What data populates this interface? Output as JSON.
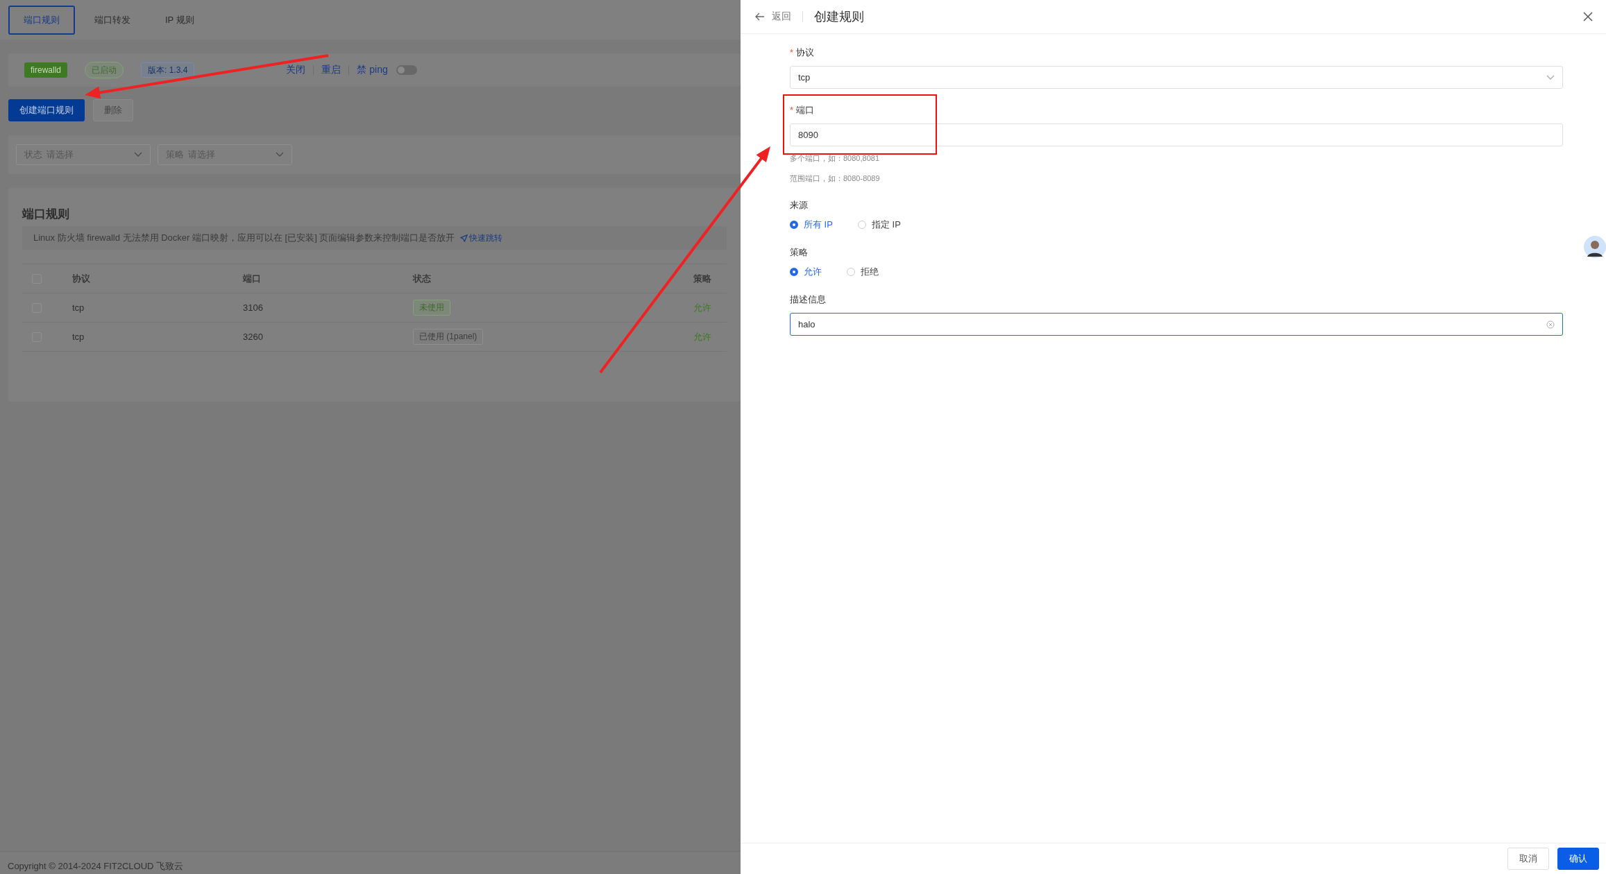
{
  "tabs": [
    {
      "label": "端口规则",
      "selected": true
    },
    {
      "label": "端口转发",
      "selected": false
    },
    {
      "label": "IP 规则",
      "selected": false
    }
  ],
  "status_bar": {
    "name": "firewalld",
    "state": "已启动",
    "version": "版本: 1.3.4",
    "actions": [
      "关闭",
      "重启"
    ],
    "ping_label": "禁 ping",
    "ping_on": false
  },
  "toolbar": [
    {
      "label": "创建端口规则",
      "kind": "primary",
      "disabled": false
    },
    {
      "label": "删除",
      "kind": "default",
      "disabled": true
    }
  ],
  "filters": [
    {
      "label": "状态",
      "placeholder": "请选择"
    },
    {
      "label": "策略",
      "placeholder": "请选择"
    }
  ],
  "rules_card": {
    "title": "端口规则",
    "notice": "Linux 防火墙 firewalld 无法禁用 Docker 端口映射，应用可以在 [已安装] 页面编辑参数来控制端口是否放开",
    "notice_link": "快速跳转",
    "all_checked": false,
    "columns": [
      "协议",
      "端口",
      "状态",
      "策略"
    ],
    "rows": [
      {
        "protocol": "tcp",
        "port": "3106",
        "status": {
          "label": "未使用",
          "kind": "unused"
        },
        "strategy": "允许",
        "checked": false
      },
      {
        "protocol": "tcp",
        "port": "3260",
        "status": {
          "label": "已使用 (1panel)",
          "kind": "used"
        },
        "strategy": "允许",
        "checked": false
      }
    ]
  },
  "footer": "Copyright © 2014-2024 FIT2CLOUD 飞致云",
  "drawer": {
    "back": "返回",
    "title": "创建规则",
    "required_mark": "*",
    "fields": [
      {
        "kind": "select",
        "label": "协议",
        "required": true,
        "value": "tcp"
      },
      {
        "kind": "input",
        "label": "端口",
        "required": true,
        "value": "8090",
        "focused": false,
        "clearable": false,
        "hints": [
          "多个端口，如：8080,8081",
          "范围端口，如：8080-8089"
        ]
      },
      {
        "kind": "radio",
        "label": "来源",
        "required": false,
        "options": [
          {
            "label": "所有 IP",
            "selected": true
          },
          {
            "label": "指定 IP",
            "selected": false
          }
        ]
      },
      {
        "kind": "radio",
        "label": "策略",
        "required": false,
        "options": [
          {
            "label": "允许",
            "selected": true
          },
          {
            "label": "拒绝",
            "selected": false
          }
        ]
      },
      {
        "kind": "input",
        "label": "描述信息",
        "required": false,
        "value": "halo",
        "focused": true,
        "clearable": true
      }
    ],
    "buttons": [
      {
        "label": "取消",
        "kind": "default"
      },
      {
        "label": "确认",
        "kind": "primary"
      }
    ]
  },
  "annotations": [
    {
      "kind": "arrow"
    },
    {
      "kind": "arrow"
    },
    {
      "kind": "frame"
    }
  ]
}
